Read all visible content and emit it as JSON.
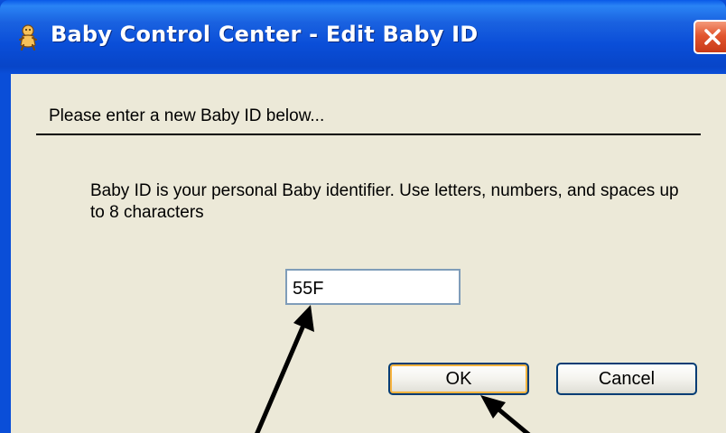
{
  "window": {
    "title": "Baby Control Center - Edit Baby ID",
    "icon": "baby-app-icon",
    "close_icon": "close-icon"
  },
  "dialog": {
    "header": "Please enter a new Baby ID below...",
    "description": "Baby ID is your personal Baby identifier.  Use letters, numbers, and spaces up to 8 characters",
    "baby_id_value": "55F",
    "ok_label": "OK",
    "cancel_label": "Cancel"
  },
  "colors": {
    "titlebar": "#0a4ed8",
    "client_bg": "#ece9d8",
    "close_button": "#e2562f",
    "button_border": "#003c74",
    "input_border": "#7f9db9"
  }
}
